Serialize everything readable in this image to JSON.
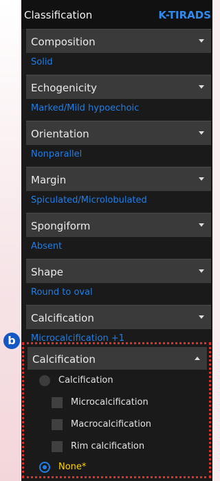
{
  "panel": {
    "title": "Classification",
    "tag": "K-TIRADS"
  },
  "groups": [
    {
      "label": "Composition",
      "value": "Solid"
    },
    {
      "label": "Echogenicity",
      "value": "Marked/Mild hypoechoic"
    },
    {
      "label": "Orientation",
      "value": "Nonparallel"
    },
    {
      "label": "Margin",
      "value": "Spiculated/Microlobulated"
    },
    {
      "label": "Spongiform",
      "value": "Absent"
    },
    {
      "label": "Shape",
      "value": "Round to oval"
    },
    {
      "label": "Calcification",
      "value": "Microcalcification +1"
    }
  ],
  "annotation_badge": "b",
  "expanded": {
    "label": "Calcification",
    "radio_calcification": "Calcification",
    "checkboxes": [
      "Microcalcification",
      "Macrocalcification",
      "Rim calcification"
    ],
    "radio_none": "None*"
  },
  "colors": {
    "accent": "#1f7ee8",
    "highlight_border": "#e0302a",
    "selected_text": "#ffd400"
  }
}
